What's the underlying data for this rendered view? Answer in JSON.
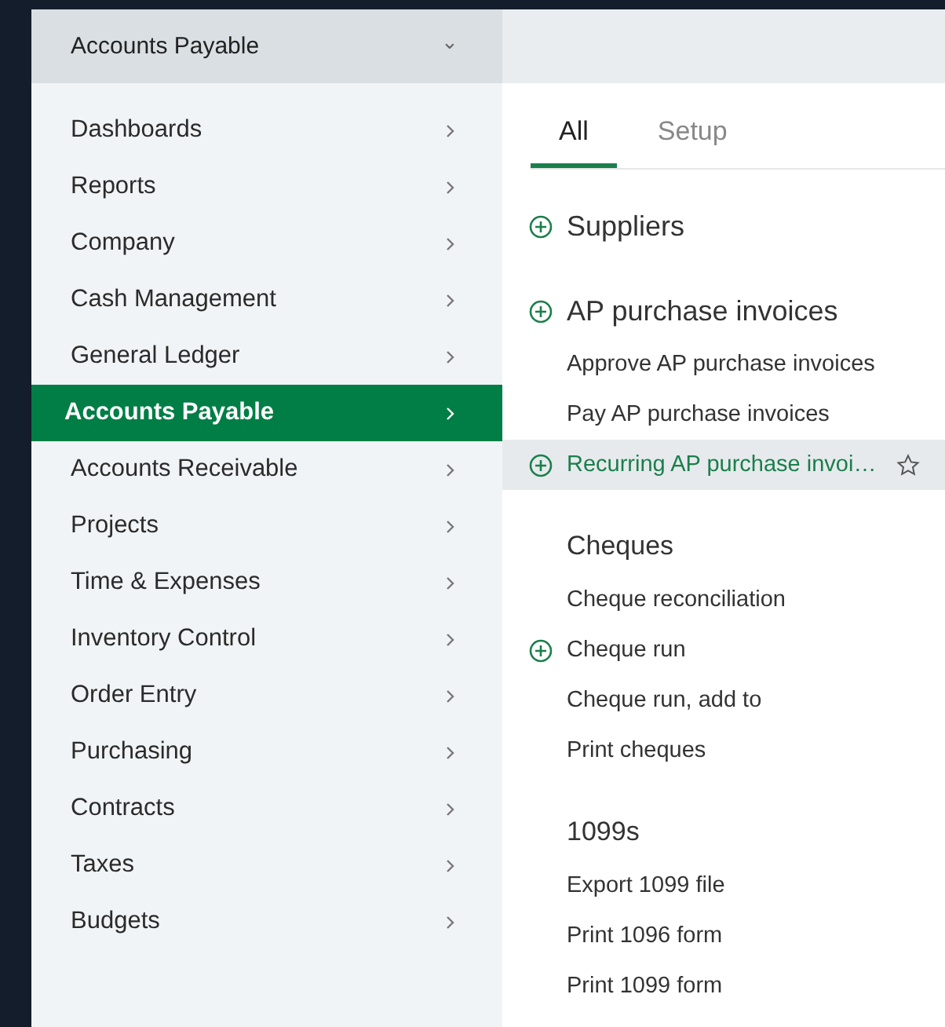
{
  "module_selector": {
    "label": "Accounts Payable",
    "caret": "⌄"
  },
  "menu": [
    {
      "label": "Dashboards",
      "selected": false
    },
    {
      "label": "Reports",
      "selected": false
    },
    {
      "label": "Company",
      "selected": false
    },
    {
      "label": "Cash Management",
      "selected": false
    },
    {
      "label": "General Ledger",
      "selected": false
    },
    {
      "label": "Accounts Payable",
      "selected": true
    },
    {
      "label": "Accounts Receivable",
      "selected": false
    },
    {
      "label": "Projects",
      "selected": false
    },
    {
      "label": "Time & Expenses",
      "selected": false
    },
    {
      "label": "Inventory Control",
      "selected": false
    },
    {
      "label": "Order Entry",
      "selected": false
    },
    {
      "label": "Purchasing",
      "selected": false
    },
    {
      "label": "Contracts",
      "selected": false
    },
    {
      "label": "Taxes",
      "selected": false
    },
    {
      "label": "Budgets",
      "selected": false
    }
  ],
  "tabs": [
    {
      "label": "All",
      "selected": true
    },
    {
      "label": "Setup",
      "selected": false
    }
  ],
  "sections": [
    {
      "heading": "Suppliers",
      "add": true
    },
    {
      "heading": "AP purchase invoices",
      "add": true,
      "items": [
        {
          "label": "Approve AP purchase invoices",
          "add": false,
          "highlighted": false
        },
        {
          "label": "Pay AP purchase invoices",
          "add": false,
          "highlighted": false
        },
        {
          "label": "Recurring AP purchase invoi…",
          "add": true,
          "highlighted": true
        }
      ]
    },
    {
      "heading": "Cheques",
      "add": false,
      "items": [
        {
          "label": "Cheque reconciliation",
          "add": false,
          "highlighted": false
        },
        {
          "label": "Cheque run",
          "add": true,
          "highlighted": false
        },
        {
          "label": "Cheque run, add to",
          "add": false,
          "highlighted": false
        },
        {
          "label": "Print cheques",
          "add": false,
          "highlighted": false
        }
      ]
    },
    {
      "heading": "1099s",
      "add": false,
      "items": [
        {
          "label": "Export 1099 file",
          "add": false,
          "highlighted": false
        },
        {
          "label": "Print 1096 form",
          "add": false,
          "highlighted": false
        },
        {
          "label": "Print 1099 form",
          "add": false,
          "highlighted": false
        }
      ]
    }
  ]
}
